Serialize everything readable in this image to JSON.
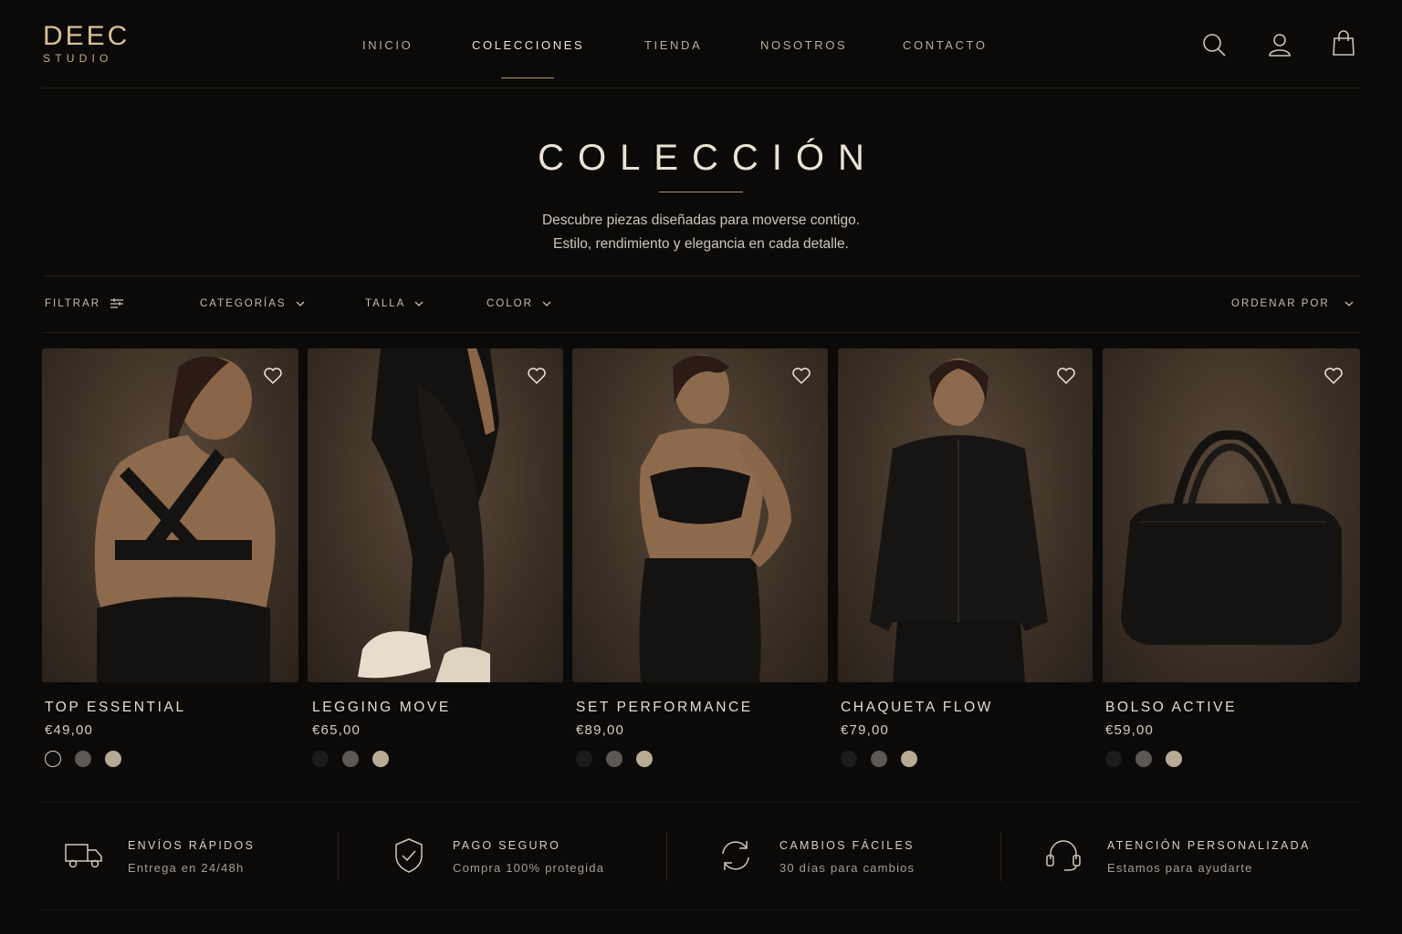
{
  "brand": {
    "name": "DEEC",
    "sub": "STUDIO",
    "accent": "#c09a62"
  },
  "nav": {
    "items": [
      {
        "label": "INICIO"
      },
      {
        "label": "COLECCIONES",
        "active": true
      },
      {
        "label": "TIENDA"
      },
      {
        "label": "NOSOTROS"
      },
      {
        "label": "CONTACTO"
      }
    ]
  },
  "header_icons": [
    "search-icon",
    "user-icon",
    "bag-icon"
  ],
  "hero": {
    "title": "COLECCIÓN",
    "line1": "Descubre piezas diseñadas para moverse contigo.",
    "line2": "Estilo, rendimiento y elegancia en cada detalle."
  },
  "filters": {
    "filter": "FILTRAR",
    "categories": "CATEGORÍAS",
    "size": "TALLA",
    "color": "COLOR",
    "sort": "ORDENAR POR"
  },
  "products": [
    {
      "name": "TOP ESSENTIAL",
      "price": "€49,00",
      "image": "woman-back-sports-top",
      "swatches": [
        "#0d0d0d",
        "#5c5955",
        "#b9aa94"
      ],
      "selected_swatch": 0
    },
    {
      "name": "LEGGING MOVE",
      "price": "€65,00",
      "image": "legs-black-leggings-sneakers",
      "swatches": [
        "#1d1c1a",
        "#5c5955",
        "#b9aa94"
      ]
    },
    {
      "name": "SET PERFORMANCE",
      "price": "€89,00",
      "image": "woman-sports-bra-set",
      "swatches": [
        "#1d1c1a",
        "#5c5955",
        "#b9aa94"
      ]
    },
    {
      "name": "CHAQUETA FLOW",
      "price": "€79,00",
      "image": "woman-black-zip-jacket",
      "swatches": [
        "#1d1c1a",
        "#5c5955",
        "#b9aa94"
      ]
    },
    {
      "name": "BOLSO ACTIVE",
      "price": "€59,00",
      "image": "black-duffel-bag",
      "swatches": [
        "#1d1c1a",
        "#5c5955",
        "#b9aa94"
      ]
    }
  ],
  "features": [
    {
      "title": "ENVÍOS RÁPIDOS",
      "text": "Entrega en 24/48h",
      "icon": "truck-icon"
    },
    {
      "title": "PAGO SEGURO",
      "text": "Compra 100% protegida",
      "icon": "shield-check-icon"
    },
    {
      "title": "CAMBIOS FÁCILES",
      "text": "30 días para cambios",
      "icon": "refresh-icon"
    },
    {
      "title": "ATENCIÓN PERSONALIZADA",
      "text": "Estamos para ayudarte",
      "icon": "headset-icon"
    }
  ]
}
